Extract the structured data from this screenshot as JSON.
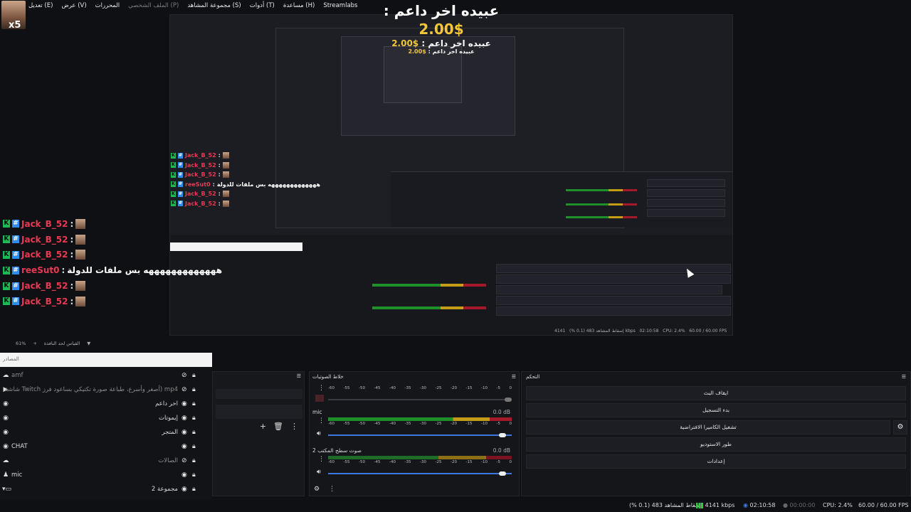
{
  "menu": {
    "badge": "x5",
    "items": [
      "Streamlabs",
      "مساعدة (H)",
      "أدوات (T)",
      "مجموعة المشاهد (S)",
      "الملف الشخصي (P)",
      "المحررات",
      "عرض (V)",
      "تعديل (E)"
    ]
  },
  "alert": {
    "line1_text": "عبيده اخر داعم :",
    "line1_amount": "$2.00",
    "line2_text": "عبيده اخر داعم :",
    "line2_amount": "$2.00",
    "line3_text": "عبيده اخر داعم :",
    "line3_amount": "$2.00"
  },
  "chat": [
    {
      "name": "Jack_B_52",
      "message": ""
    },
    {
      "name": "Jack_B_52",
      "message": ""
    },
    {
      "name": "Jack_B_52",
      "message": ""
    },
    {
      "name": "reeSut0",
      "message": "هههههههههههههه بس ملفات للدولة"
    },
    {
      "name": "Jack_B_52",
      "message": ""
    },
    {
      "name": "Jack_B_52",
      "message": ""
    }
  ],
  "zoom": {
    "level": "61%",
    "label": "القياس لحد النافذة"
  },
  "sources": {
    "header": "المصادر",
    "items": [
      {
        "label": "amf",
        "icon": "cloud-icon",
        "dim": true,
        "side": "left"
      },
      {
        "label": "شاشة Twitch أصغر وأسرع، طباعة صورة تكتيكي بساعود فرز) mp4",
        "icon": "play-icon",
        "dim": true,
        "side": "right"
      },
      {
        "label": "اخر داعم",
        "icon": "globe-icon",
        "dim": false,
        "side": "right"
      },
      {
        "label": "إيموتات",
        "icon": "globe-icon",
        "dim": false,
        "side": "right"
      },
      {
        "label": "المتجر",
        "icon": "globe-icon",
        "dim": false,
        "side": "right"
      },
      {
        "label": "CHAT",
        "icon": "globe-icon",
        "dim": false,
        "side": "left"
      },
      {
        "label": "الصالات",
        "icon": "cloud-icon",
        "dim": true,
        "side": "right"
      },
      {
        "label": "mic",
        "icon": "mic-icon",
        "dim": false,
        "side": "left"
      },
      {
        "label": "مجموعة 2",
        "icon": "folder-icon",
        "dim": false,
        "side": "right"
      }
    ]
  },
  "mixer": {
    "title": "خلاط الصوتيات",
    "ticks": [
      "-60",
      "-55",
      "-50",
      "-45",
      "-40",
      "-35",
      "-30",
      "-25",
      "-20",
      "-15",
      "-10",
      "-5",
      "0"
    ],
    "channels": [
      {
        "name": "",
        "db": ""
      },
      {
        "name": "mic",
        "db": "0.0 dB"
      },
      {
        "name": "صوت سطح المكتب 2",
        "db": "0.0 dB"
      }
    ]
  },
  "controls": {
    "title": "التحكم",
    "buttons": [
      "ايقاف البث",
      "بدء التسجيل",
      "تشغيل الكاميرا الافتراضية",
      "طور الاستوديو",
      "إعدادات"
    ]
  },
  "status": {
    "dropped": "إسقاط المشاهد 483 (0.1 %)",
    "bitrate": "4141 kbps",
    "live_time": "02:10:58",
    "rec_time": "00:00:00",
    "cpu": "CPU: 2.4%",
    "fps": "60.00 / 60.00 FPS"
  },
  "colors": {
    "accent": "#f3c63a",
    "chat_name": "#e63a52",
    "meter_green": "#1f8f2c",
    "meter_yellow": "#c49c17",
    "meter_red": "#a7192a"
  }
}
